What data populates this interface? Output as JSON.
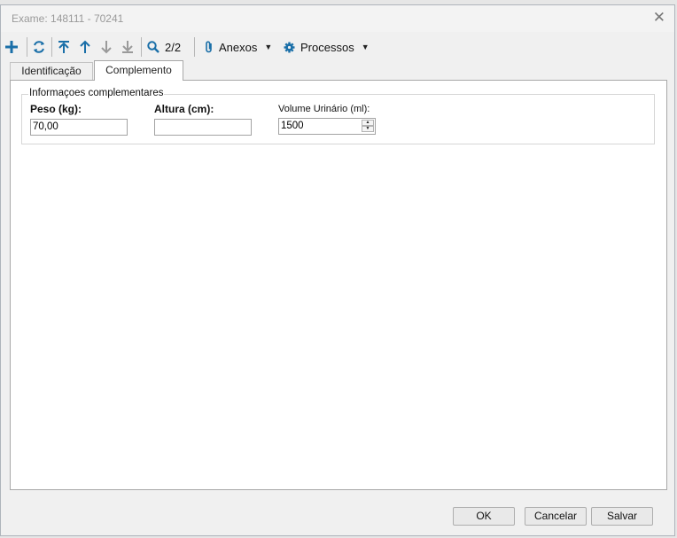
{
  "window": {
    "title": "Exame: 148111 - 70241"
  },
  "toolbar": {
    "counter": "2/2",
    "anexos_label": "Anexos",
    "processos_label": "Processos"
  },
  "tabs": [
    {
      "label": "Identificação",
      "active": false
    },
    {
      "label": "Complemento",
      "active": true
    }
  ],
  "group": {
    "title": "Informaçoes complementares",
    "peso": {
      "label": "Peso (kg):",
      "value": "70,00"
    },
    "altura": {
      "label": "Altura (cm):",
      "value": ""
    },
    "volume": {
      "label": "Volume Urinário (ml):",
      "value": "1500"
    }
  },
  "buttons": {
    "ok": "OK",
    "cancel": "Cancelar",
    "save": "Salvar"
  },
  "colors": {
    "accent": "#1a6fa8",
    "panel": "#ffffff",
    "chrome": "#f0f0f0"
  }
}
